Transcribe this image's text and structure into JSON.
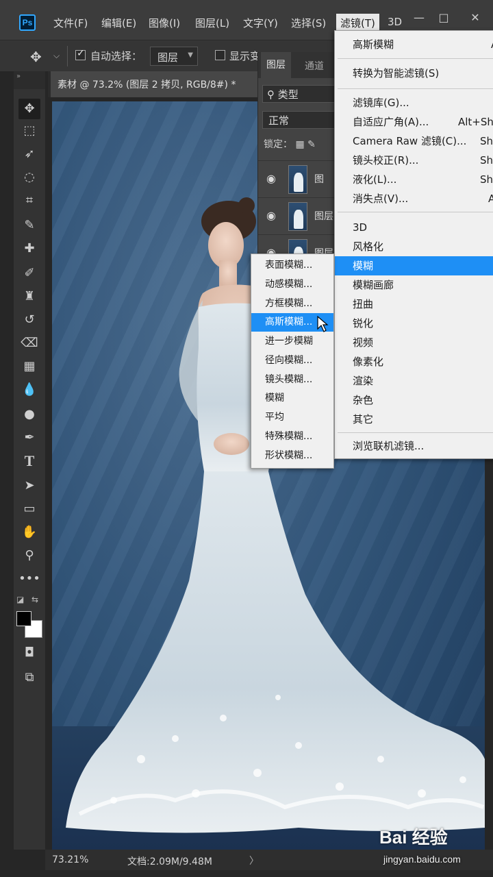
{
  "app": {
    "logo": "Ps"
  },
  "menubar": {
    "items": [
      "文件(F)",
      "编辑(E)",
      "图像(I)",
      "图层(L)",
      "文字(Y)",
      "选择(S)",
      "滤镜(T)",
      "3D"
    ],
    "active_index": 6,
    "window_controls": [
      "—",
      "□",
      "✕"
    ]
  },
  "options": {
    "auto_select_label": "自动选择：",
    "auto_select_checked": true,
    "layer_select_value": "图层",
    "show_transform_label": "显示变",
    "show_transform_checked": false
  },
  "document": {
    "tab_title": "素材 @ 73.2% (图层 2 拷贝, RGB/8#) *"
  },
  "layers_panel": {
    "tabs": [
      "图层",
      "通道"
    ],
    "filter_label": "类型",
    "blend_mode": "正常",
    "lock_label": "锁定：",
    "rows": [
      {
        "name": "图"
      },
      {
        "name": "图层"
      },
      {
        "name": "图层"
      }
    ]
  },
  "filter_menu": {
    "items": [
      {
        "label": "高斯模糊",
        "shortcut": "A"
      },
      {
        "label": "转换为智能滤镜(S)",
        "shortcut": ""
      },
      {
        "label": "滤镜库(G)...",
        "shortcut": ""
      },
      {
        "label": "自适应广角(A)...",
        "shortcut": "Alt+Shi"
      },
      {
        "label": "Camera Raw 滤镜(C)...",
        "shortcut": "Shi"
      },
      {
        "label": "镜头校正(R)...",
        "shortcut": "Shi"
      },
      {
        "label": "液化(L)...",
        "shortcut": "Shi"
      },
      {
        "label": "消失点(V)...",
        "shortcut": "A"
      },
      {
        "label": "3D",
        "shortcut": ""
      },
      {
        "label": "风格化",
        "shortcut": ""
      },
      {
        "label": "模糊",
        "shortcut": ""
      },
      {
        "label": "模糊画廊",
        "shortcut": ""
      },
      {
        "label": "扭曲",
        "shortcut": ""
      },
      {
        "label": "锐化",
        "shortcut": ""
      },
      {
        "label": "视频",
        "shortcut": ""
      },
      {
        "label": "像素化",
        "shortcut": ""
      },
      {
        "label": "渲染",
        "shortcut": ""
      },
      {
        "label": "杂色",
        "shortcut": ""
      },
      {
        "label": "其它",
        "shortcut": ""
      },
      {
        "label": "浏览联机滤镜...",
        "shortcut": ""
      }
    ],
    "highlighted": "模糊"
  },
  "blur_submenu": {
    "items": [
      "表面模糊...",
      "动感模糊...",
      "方框模糊...",
      "高斯模糊...",
      "进一步模糊",
      "径向模糊...",
      "镜头模糊...",
      "模糊",
      "平均",
      "特殊模糊...",
      "形状模糊..."
    ],
    "highlighted": "高斯模糊..."
  },
  "status": {
    "zoom": "73.21%",
    "doc_info": "文档:2.09M/9.48M",
    "arrow": "〉"
  },
  "watermark": {
    "brand": "Bai  经验",
    "url": "jingyan.baidu.com"
  },
  "tools": [
    "move-icon",
    "marquee-icon",
    "lasso-icon",
    "quick-select-icon",
    "crop-icon",
    "eyedropper-icon",
    "healing-icon",
    "brush-icon",
    "stamp-icon",
    "history-brush-icon",
    "eraser-icon",
    "gradient-icon",
    "blur-drop-icon",
    "dodge-icon",
    "pen-icon",
    "type-icon",
    "path-select-icon",
    "rectangle-icon",
    "hand-icon",
    "zoom-icon",
    "more-icon"
  ],
  "colors": {
    "highlight": "#1e8ff5",
    "ps_blue": "#31a8ff",
    "background": "#262626"
  }
}
